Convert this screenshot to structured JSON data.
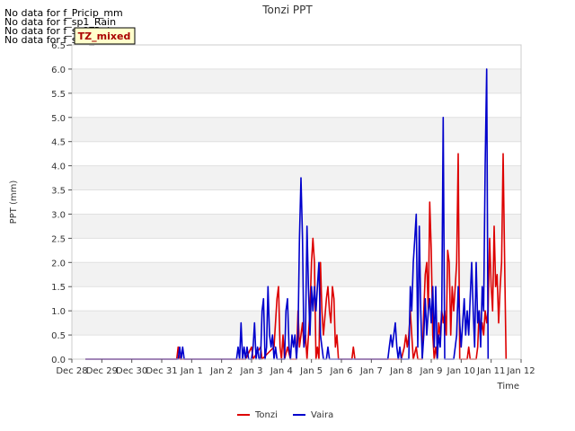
{
  "no_data_messages": [
    "No data for f_Pricip_mm",
    "No data for f_sp1_Rain",
    "No data for f_sp2_Rain",
    "No data for f_sp3_Rain"
  ],
  "badge": "TZ_mixed",
  "chart_data": {
    "type": "line",
    "title": "Tonzi PPT",
    "xlabel": "Time",
    "ylabel": "PPT (mm)",
    "x_ticks": [
      "Dec 28",
      "Dec 29",
      "Dec 30",
      "Dec 31",
      "Jan 1",
      "Jan 2",
      "Jan 3",
      "Jan 4",
      "Jan 5",
      "Jan 6",
      "Jan 7",
      "Jan 8",
      "Jan 9",
      "Jan 10",
      "Jan 11",
      "Jan 12"
    ],
    "xlim": [
      0,
      15
    ],
    "ylim": [
      0,
      6.5
    ],
    "y_ticks": [
      "0.0",
      "0.5",
      "1.0",
      "1.5",
      "2.0",
      "2.5",
      "3.0",
      "3.5",
      "4.0",
      "4.5",
      "5.0",
      "5.5",
      "6.0",
      "6.5"
    ],
    "grid": "horizontal bands",
    "legend_position": "bottom",
    "series": [
      {
        "name": "Tonzi",
        "color": "#dd0000",
        "x_unit": "days since Dec 28 00:00",
        "points": [
          [
            0.45,
            0
          ],
          [
            3.5,
            0
          ],
          [
            3.55,
            0.25
          ],
          [
            3.6,
            0
          ],
          [
            5.8,
            0
          ],
          [
            6.0,
            0.25
          ],
          [
            6.05,
            0
          ],
          [
            6.3,
            0.25
          ],
          [
            6.35,
            0
          ],
          [
            6.75,
            0.25
          ],
          [
            6.85,
            1.25
          ],
          [
            6.9,
            1.5
          ],
          [
            6.95,
            0.25
          ],
          [
            7.0,
            0
          ],
          [
            7.05,
            0.5
          ],
          [
            7.1,
            0
          ],
          [
            7.2,
            0.25
          ],
          [
            7.3,
            0
          ],
          [
            7.5,
            0
          ],
          [
            7.55,
            1.0
          ],
          [
            7.6,
            0.25
          ],
          [
            7.65,
            0.5
          ],
          [
            7.7,
            0.75
          ],
          [
            7.75,
            0.25
          ],
          [
            7.8,
            0.5
          ],
          [
            7.85,
            0
          ],
          [
            7.95,
            1.0
          ],
          [
            8.0,
            2.0
          ],
          [
            8.05,
            2.5
          ],
          [
            8.1,
            2.0
          ],
          [
            8.15,
            0
          ],
          [
            8.2,
            0.25
          ],
          [
            8.25,
            0
          ],
          [
            8.3,
            2.0
          ],
          [
            8.35,
            1.0
          ],
          [
            8.4,
            0.5
          ],
          [
            8.5,
            1.25
          ],
          [
            8.55,
            1.5
          ],
          [
            8.6,
            1.0
          ],
          [
            8.65,
            0.75
          ],
          [
            8.7,
            1.5
          ],
          [
            8.75,
            1.25
          ],
          [
            8.8,
            0.25
          ],
          [
            8.85,
            0.5
          ],
          [
            8.9,
            0
          ],
          [
            9.35,
            0
          ],
          [
            9.4,
            0.25
          ],
          [
            9.45,
            0
          ],
          [
            11.0,
            0
          ],
          [
            11.1,
            0.25
          ],
          [
            11.15,
            0.5
          ],
          [
            11.2,
            0.25
          ],
          [
            11.25,
            0.5
          ],
          [
            11.3,
            1.0
          ],
          [
            11.35,
            0.5
          ],
          [
            11.4,
            0
          ],
          [
            11.5,
            0.25
          ],
          [
            11.55,
            0
          ],
          [
            11.7,
            0
          ],
          [
            11.75,
            1.0
          ],
          [
            11.8,
            1.75
          ],
          [
            11.85,
            2.0
          ],
          [
            11.9,
            1.0
          ],
          [
            11.95,
            3.25
          ],
          [
            12.0,
            2.25
          ],
          [
            12.05,
            0.5
          ],
          [
            12.1,
            0
          ],
          [
            12.15,
            0.25
          ],
          [
            12.2,
            0
          ],
          [
            12.25,
            0.75
          ],
          [
            12.3,
            0.5
          ],
          [
            12.35,
            1.0
          ],
          [
            12.4,
            0.75
          ],
          [
            12.45,
            1.0
          ],
          [
            12.5,
            0.5
          ],
          [
            12.55,
            2.25
          ],
          [
            12.6,
            2.0
          ],
          [
            12.65,
            0.5
          ],
          [
            12.7,
            1.5
          ],
          [
            12.75,
            1.0
          ],
          [
            12.8,
            1.5
          ],
          [
            12.85,
            2.0
          ],
          [
            12.9,
            4.25
          ],
          [
            12.95,
            0
          ],
          [
            13.2,
            0
          ],
          [
            13.25,
            0.25
          ],
          [
            13.3,
            0
          ],
          [
            13.5,
            0
          ],
          [
            13.55,
            0.25
          ],
          [
            13.6,
            1.0
          ],
          [
            13.65,
            0.5
          ],
          [
            13.7,
            0.75
          ],
          [
            13.75,
            0.5
          ],
          [
            13.8,
            1.0
          ],
          [
            13.85,
            0.75
          ],
          [
            13.9,
            1.0
          ],
          [
            13.95,
            2.5
          ],
          [
            14.0,
            1.5
          ],
          [
            14.05,
            1.0
          ],
          [
            14.1,
            2.75
          ],
          [
            14.15,
            1.5
          ],
          [
            14.2,
            1.75
          ],
          [
            14.25,
            0.75
          ],
          [
            14.3,
            1.5
          ],
          [
            14.35,
            2.0
          ],
          [
            14.4,
            4.25
          ],
          [
            14.45,
            2.0
          ],
          [
            14.5,
            0
          ]
        ]
      },
      {
        "name": "Vaira",
        "color": "#0000cc",
        "x_unit": "days since Dec 28 00:00",
        "points": [
          [
            0.45,
            0
          ],
          [
            3.55,
            0
          ],
          [
            3.6,
            0.25
          ],
          [
            3.65,
            0
          ],
          [
            3.7,
            0.25
          ],
          [
            3.75,
            0
          ],
          [
            5.5,
            0
          ],
          [
            5.55,
            0.25
          ],
          [
            5.6,
            0
          ],
          [
            5.65,
            0.75
          ],
          [
            5.7,
            0
          ],
          [
            5.75,
            0.25
          ],
          [
            5.8,
            0
          ],
          [
            5.85,
            0.25
          ],
          [
            5.9,
            0
          ],
          [
            6.0,
            0
          ],
          [
            6.05,
            0.25
          ],
          [
            6.1,
            0.75
          ],
          [
            6.15,
            0
          ],
          [
            6.2,
            0.25
          ],
          [
            6.25,
            0
          ],
          [
            6.3,
            0
          ],
          [
            6.35,
            1.0
          ],
          [
            6.4,
            1.25
          ],
          [
            6.45,
            0
          ],
          [
            6.5,
            0.25
          ],
          [
            6.55,
            1.5
          ],
          [
            6.6,
            0.5
          ],
          [
            6.65,
            0.25
          ],
          [
            6.7,
            0.5
          ],
          [
            6.75,
            0
          ],
          [
            6.8,
            0.25
          ],
          [
            6.85,
            0
          ],
          [
            7.1,
            0
          ],
          [
            7.15,
            1.0
          ],
          [
            7.2,
            1.25
          ],
          [
            7.25,
            0.25
          ],
          [
            7.3,
            0
          ],
          [
            7.35,
            0.5
          ],
          [
            7.4,
            0.25
          ],
          [
            7.45,
            0.5
          ],
          [
            7.5,
            0
          ],
          [
            7.55,
            0.5
          ],
          [
            7.6,
            2.5
          ],
          [
            7.65,
            3.75
          ],
          [
            7.7,
            2.5
          ],
          [
            7.75,
            0.25
          ],
          [
            7.8,
            0.5
          ],
          [
            7.85,
            2.75
          ],
          [
            7.9,
            1.5
          ],
          [
            7.95,
            0.5
          ],
          [
            8.0,
            1.5
          ],
          [
            8.05,
            1.0
          ],
          [
            8.1,
            1.5
          ],
          [
            8.15,
            1.0
          ],
          [
            8.2,
            1.5
          ],
          [
            8.25,
            2.0
          ],
          [
            8.3,
            0.5
          ],
          [
            8.35,
            0.25
          ],
          [
            8.4,
            0
          ],
          [
            8.5,
            0
          ],
          [
            8.55,
            0.25
          ],
          [
            8.6,
            0
          ],
          [
            10.55,
            0
          ],
          [
            10.6,
            0.25
          ],
          [
            10.65,
            0.5
          ],
          [
            10.7,
            0.25
          ],
          [
            10.75,
            0.5
          ],
          [
            10.8,
            0.75
          ],
          [
            10.85,
            0.25
          ],
          [
            10.9,
            0
          ],
          [
            10.95,
            0.25
          ],
          [
            11.0,
            0
          ],
          [
            11.25,
            0
          ],
          [
            11.3,
            1.5
          ],
          [
            11.35,
            1.0
          ],
          [
            11.4,
            2.0
          ],
          [
            11.45,
            2.5
          ],
          [
            11.5,
            3.0
          ],
          [
            11.55,
            0.25
          ],
          [
            11.6,
            2.75
          ],
          [
            11.65,
            1.0
          ],
          [
            11.7,
            0
          ],
          [
            11.75,
            0.5
          ],
          [
            11.8,
            1.25
          ],
          [
            11.85,
            0.5
          ],
          [
            11.9,
            1.0
          ],
          [
            11.95,
            1.25
          ],
          [
            12.0,
            0.75
          ],
          [
            12.05,
            1.5
          ],
          [
            12.1,
            0.25
          ],
          [
            12.15,
            1.5
          ],
          [
            12.2,
            0
          ],
          [
            12.25,
            0.5
          ],
          [
            12.3,
            0.25
          ],
          [
            12.35,
            1.0
          ],
          [
            12.4,
            5.0
          ],
          [
            12.45,
            0
          ],
          [
            12.75,
            0
          ],
          [
            12.8,
            0.25
          ],
          [
            12.85,
            0.5
          ],
          [
            12.9,
            1.5
          ],
          [
            12.95,
            0.75
          ],
          [
            13.0,
            0.25
          ],
          [
            13.05,
            0.75
          ],
          [
            13.1,
            1.25
          ],
          [
            13.15,
            0.5
          ],
          [
            13.2,
            1.0
          ],
          [
            13.25,
            0.5
          ],
          [
            13.3,
            1.25
          ],
          [
            13.35,
            2.0
          ],
          [
            13.4,
            1.0
          ],
          [
            13.45,
            0.25
          ],
          [
            13.5,
            2.0
          ],
          [
            13.55,
            0.75
          ],
          [
            13.6,
            1.0
          ],
          [
            13.65,
            0.25
          ],
          [
            13.7,
            1.5
          ],
          [
            13.75,
            1.0
          ],
          [
            13.8,
            4.0
          ],
          [
            13.85,
            6.0
          ],
          [
            13.9,
            0
          ]
        ]
      }
    ]
  }
}
